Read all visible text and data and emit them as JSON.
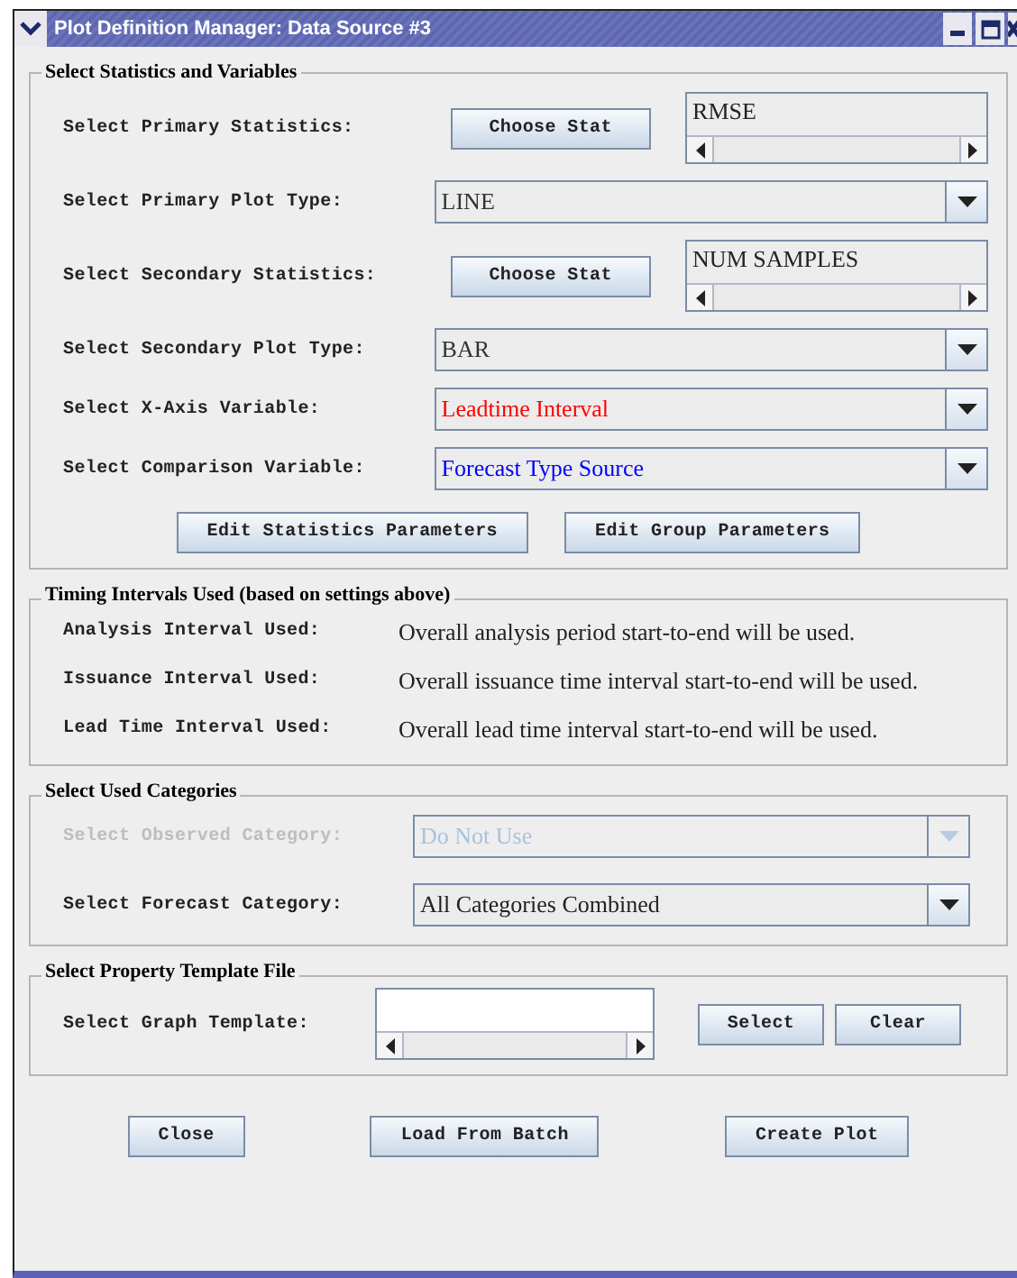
{
  "window": {
    "title": "Plot Definition Manager: Data Source #3"
  },
  "stats_group": {
    "title": "Select Statistics and Variables",
    "rows": [
      {
        "kind": "stat",
        "label": "Select Primary Statistics:",
        "button": "Choose Stat",
        "value": "RMSE"
      },
      {
        "kind": "combo",
        "label": "Select Primary Plot Type:",
        "value": "LINE",
        "color": "#333333"
      },
      {
        "kind": "stat",
        "label": "Select Secondary Statistics:",
        "button": "Choose Stat",
        "value": "NUM SAMPLES"
      },
      {
        "kind": "combo",
        "label": "Select Secondary Plot Type:",
        "value": "BAR",
        "color": "#333333"
      },
      {
        "kind": "combo",
        "label": "Select X-Axis Variable:",
        "value": "Leadtime Interval",
        "color": "#ff0000"
      },
      {
        "kind": "combo",
        "label": "Select Comparison Variable:",
        "value": "Forecast Type Source",
        "color": "#0000ff"
      }
    ],
    "buttons": [
      "Edit Statistics Parameters",
      "Edit Group Parameters"
    ]
  },
  "timing_group": {
    "title": "Timing Intervals Used (based on settings above)",
    "rows": [
      {
        "label": "Analysis Interval Used:",
        "value": "Overall analysis period start-to-end will be used."
      },
      {
        "label": "Issuance Interval Used:",
        "value": "Overall issuance time interval start-to-end will be used."
      },
      {
        "label": "Lead Time Interval Used:",
        "value": "Overall lead time interval start-to-end will be used."
      }
    ]
  },
  "categories_group": {
    "title": "Select Used Categories",
    "rows": [
      {
        "label": "Select Observed Category:",
        "value": "Do Not Use",
        "disabled": true
      },
      {
        "label": "Select Forecast Category:",
        "value": "All Categories Combined",
        "disabled": false
      }
    ]
  },
  "template_group": {
    "title": "Select Property Template File",
    "label": "Select Graph Template:",
    "buttons": [
      "Select",
      "Clear"
    ]
  },
  "buttons": [
    "Close",
    "Load From Batch",
    "Create Plot"
  ]
}
